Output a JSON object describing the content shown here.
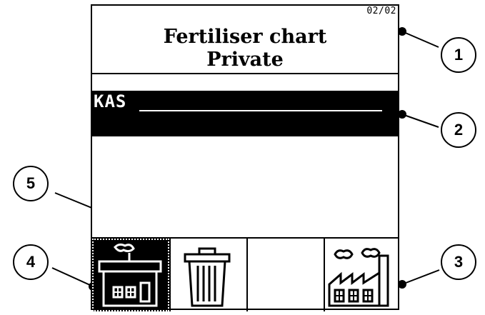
{
  "screen": {
    "page_indicator": "02/02",
    "title_line1": "Fertiliser chart",
    "title_line2": "Private",
    "selected_entry": "KAS"
  },
  "softkeys": [
    {
      "icon": "farmhouse-icon",
      "selected": true
    },
    {
      "icon": "trash-can-icon",
      "selected": false
    },
    {
      "icon": "empty-slot",
      "selected": false
    },
    {
      "icon": "factory-icon",
      "selected": false
    }
  ],
  "callouts": [
    "1",
    "2",
    "3",
    "4",
    "5"
  ]
}
